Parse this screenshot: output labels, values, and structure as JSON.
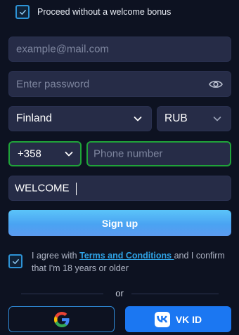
{
  "bonus": {
    "checked": true,
    "label": "Proceed without a welcome bonus"
  },
  "form": {
    "email_placeholder": "example@mail.com",
    "password_placeholder": "Enter password",
    "country_value": "Finland",
    "currency_value": "RUB",
    "phone_code_value": "+358",
    "phone_placeholder": "Phone number",
    "promo_value": "WELCOME"
  },
  "signup_label": "Sign up",
  "agreement": {
    "checked": true,
    "text_before": "I agree with ",
    "link_text": "Terms and Conditions ",
    "text_after": "and I confirm that I'm 18 years or older"
  },
  "divider_text": "or",
  "social": {
    "google_icon": "google-icon",
    "vk_label": "VK ID"
  },
  "colors": {
    "background": "#0d1221",
    "field": "#262c47",
    "accent": "#2fa3e6",
    "valid_border": "#1fa339",
    "vk_blue": "#1b77f2"
  }
}
